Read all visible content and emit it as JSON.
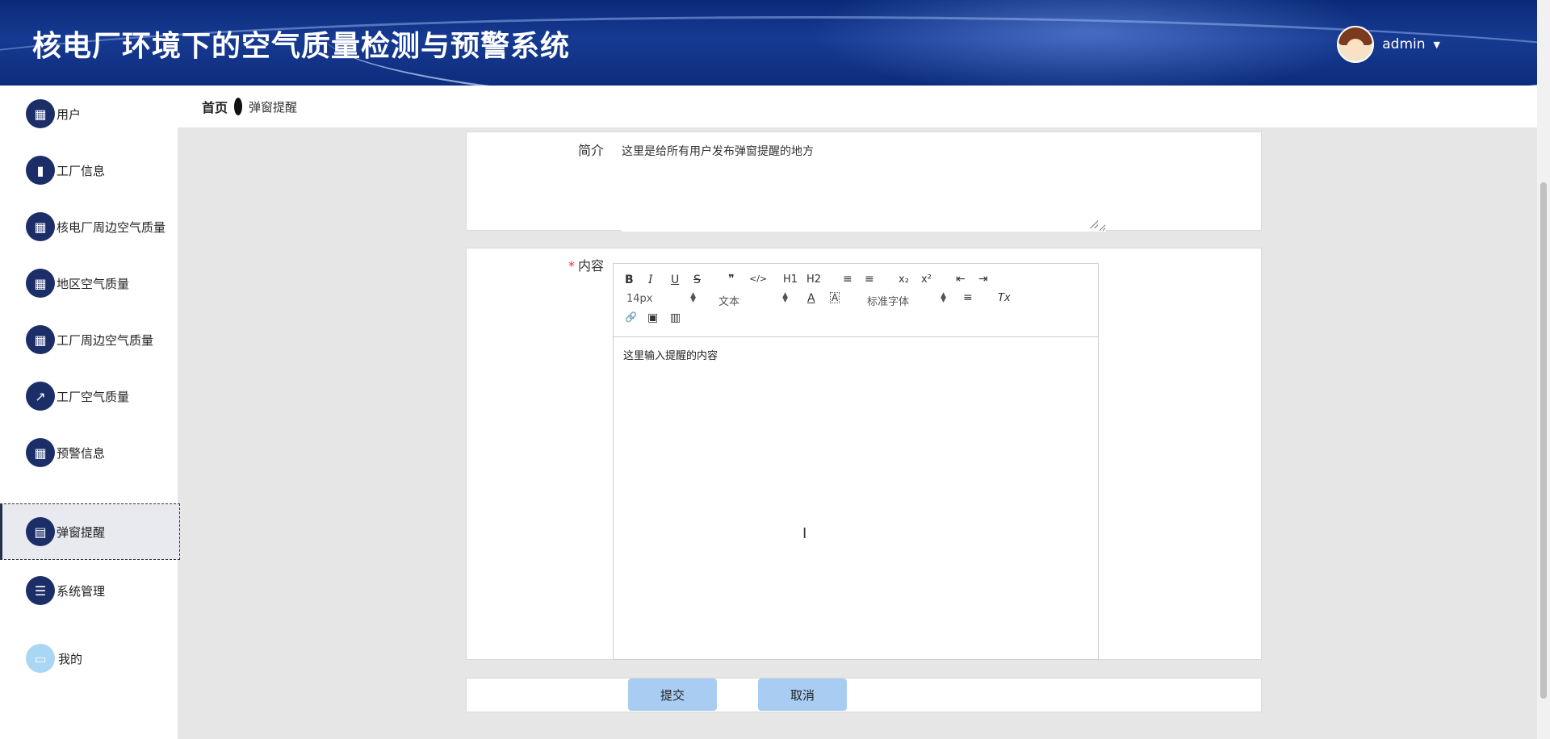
{
  "header": {
    "title": "核电厂环境下的空气质量检测与预警系统",
    "user": "admin",
    "caret": "▼"
  },
  "breadcrumb": {
    "home": "首页",
    "current": "弹窗提醒"
  },
  "sidebar": {
    "items": [
      {
        "label": "用户",
        "icon": "grid-icon",
        "glyph": "▦"
      },
      {
        "label": "工厂信息",
        "icon": "bar-chart-icon",
        "glyph": "▮"
      },
      {
        "label": "核电厂周边空气质量",
        "icon": "table-icon",
        "glyph": "▦"
      },
      {
        "label": "地区空气质量",
        "icon": "grid-icon",
        "glyph": "▦"
      },
      {
        "label": "工厂周边空气质量",
        "icon": "grid-icon",
        "glyph": "▦"
      },
      {
        "label": "工厂空气质量",
        "icon": "line-chart-icon",
        "glyph": "↗"
      },
      {
        "label": "预警信息",
        "icon": "grid-icon",
        "glyph": "▦"
      },
      {
        "label": "弹窗提醒",
        "icon": "clipboard-icon",
        "glyph": "▤",
        "active": true
      },
      {
        "label": "系统管理",
        "icon": "list-icon",
        "glyph": "☰"
      },
      {
        "label": "我的",
        "icon": "wallet-icon",
        "glyph": "▭"
      }
    ]
  },
  "form": {
    "intro_label": "简介",
    "intro_value": "这里是给所有用户发布弹窗提醒的地方",
    "content_required_mark": "*",
    "content_label": "内容",
    "editor": {
      "font_size": "14px",
      "text_type": "文本",
      "font_family": "标准字体",
      "body_text": "这里输入提醒的内容",
      "tools": {
        "bold": "B",
        "italic": "I",
        "underline": "U",
        "strike": "S",
        "quote": "❞",
        "code": "</>",
        "h1": "H1",
        "h2": "H2",
        "ordered_list": "≡",
        "bullet_list": "≡",
        "sub": "x₂",
        "sup": "x²",
        "outdent": "⇤",
        "indent": "⇥",
        "font_color": "A",
        "bg_color": "A",
        "align": "≡",
        "clear": "Tx",
        "link": "🔗",
        "image": "▣",
        "video": "▥"
      }
    },
    "submit_label": "提交",
    "cancel_label": "取消"
  },
  "colors": {
    "header_blue": "#163a92",
    "menu_icon_bg": "#1c2e68",
    "button_bg": "#a9ccf2"
  }
}
